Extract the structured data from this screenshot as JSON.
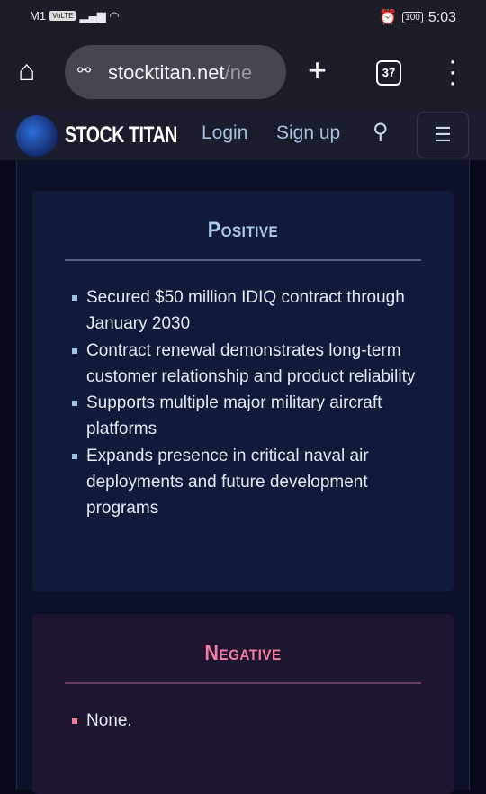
{
  "status_bar": {
    "carrier": "M1",
    "network_badge": "VoLTE",
    "battery": "100",
    "time": "5:03"
  },
  "browser": {
    "url_host": "stocktitan.net",
    "url_path": "/ne",
    "tab_count": "37"
  },
  "site_header": {
    "brand": "STOCK TITAN",
    "login": "Login",
    "signup": "Sign up"
  },
  "positive": {
    "title": "Positive",
    "color": "#a8c8ec",
    "items": [
      "Secured $50 million IDIQ contract through January 2030",
      "Contract renewal demonstrates long-term customer relationship and product reliability",
      "Supports multiple major military aircraft platforms",
      "Expands presence in critical naval air deployments and future development programs"
    ]
  },
  "negative": {
    "title": "Negative",
    "color": "#f07c9e",
    "items": [
      "None."
    ]
  }
}
